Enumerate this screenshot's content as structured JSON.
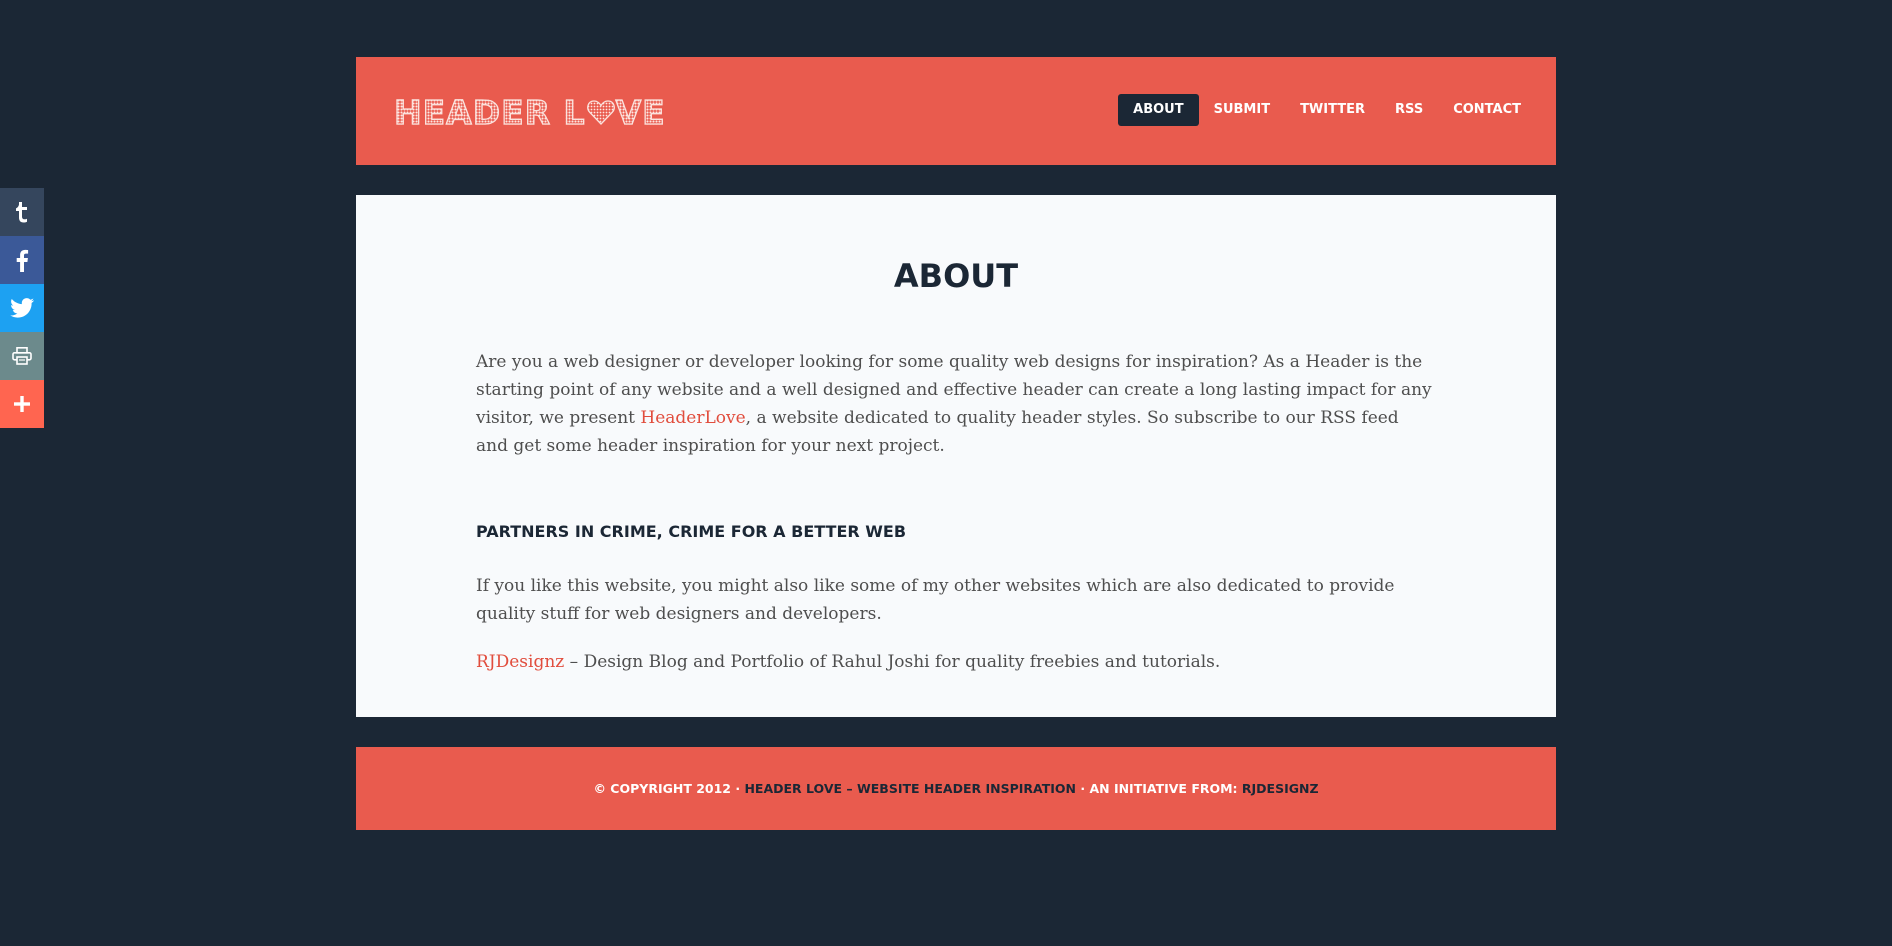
{
  "share_bar": {
    "items": [
      {
        "name": "tumblr",
        "icon": "tumblr-icon",
        "color": "#35465d"
      },
      {
        "name": "facebook",
        "icon": "facebook-icon",
        "color": "#3b5998"
      },
      {
        "name": "twitter",
        "icon": "twitter-icon",
        "color": "#1da1f2"
      },
      {
        "name": "print",
        "icon": "print-icon",
        "color": "#6c8a8c"
      },
      {
        "name": "more",
        "icon": "plus-icon",
        "color": "#ff6550"
      }
    ]
  },
  "header": {
    "logo_before": "HEADER L",
    "logo_after": "VE",
    "nav": [
      "ABOUT",
      "SUBMIT",
      "TWITTER",
      "RSS",
      "CONTACT"
    ],
    "active": "ABOUT"
  },
  "main": {
    "title": "ABOUT",
    "intro_before": "Are you a web designer or developer looking for some quality web designs for inspiration? As a Header is the starting point of any website and a well designed and effective header can create a long lasting impact for any visitor, we present ",
    "intro_link": "HeaderLove",
    "intro_after": ", a website dedicated to quality header styles. So subscribe to our RSS feed and get some header inspiration for your next project.",
    "partners_heading": "PARTNERS IN CRIME, CRIME FOR A BETTER WEB",
    "partners_text": "If you like this website, you might also like some of my other websites which are also dedicated to provide quality stuff for web designers and developers.",
    "rj_link": "RJDesignz",
    "rj_text": " – Design Blog and Portfolio of Rahul Joshi for quality freebies and tutorials."
  },
  "footer": {
    "copyright": "© COPYRIGHT 2012 · ",
    "site_link": "HEADER LOVE – WEBSITE HEADER INSPIRATION",
    "initiative": " · AN INITIATIVE FROM: ",
    "author_link": "RJDESIGNZ"
  },
  "colors": {
    "background": "#1b2735",
    "accent": "#e95b4e",
    "link": "#e14d3d",
    "content_bg": "#f8fafc"
  }
}
